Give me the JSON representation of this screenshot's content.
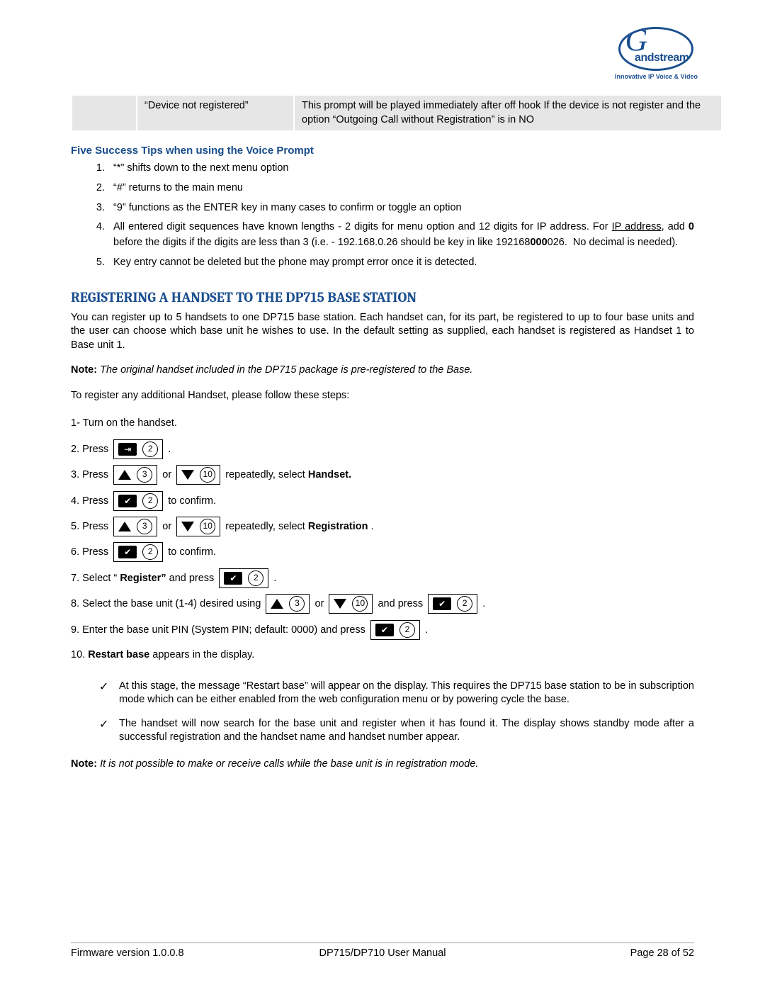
{
  "logo": {
    "brand": "Grandstream",
    "tagline": "Innovative IP Voice & Video"
  },
  "prompt_table": {
    "col1": "“Device not registered”",
    "col2": "This prompt will be played immediately after off hook If the device is not register and the option “Outgoing Call without Registration” is in NO"
  },
  "tips": {
    "heading": "Five Success Tips when using the Voice Prompt",
    "items": [
      "“*” shifts down to the next menu option",
      "“#” returns to the main menu",
      "“9” functions as the ENTER key in many cases to confirm or toggle an option",
      "All entered digit sequences have known lengths - 2 digits for menu option and 12 digits for IP address. For IP address, add 0 before the digits if the digits are less than 3 (i.e. - 192.168.0.26 should be key in like 192168000026.  No decimal is needed).",
      "Key entry cannot be deleted but the phone may prompt error once it is detected."
    ]
  },
  "section": {
    "heading": "REGISTERING A HANDSET TO THE DP715 BASE STATION",
    "p1": "You can register up to 5 handsets to one DP715 base station. Each handset can, for its part, be registered to up to four base units and the user can choose which base unit he wishes to use. In the default setting as supplied, each handset is registered as Handset 1 to Base unit 1.",
    "note1_label": "Note:",
    "note1_body": " The original handset included in the DP715 package is pre-registered to the Base.",
    "p2": "To register any additional Handset, please follow these steps:",
    "steps": {
      "s1": "1- Turn on the handset.",
      "s2_a": "2.  Press ",
      "s2_b": " .",
      "s3_a": "3.  Press ",
      "s3_or": "  or  ",
      "s3_b": " repeatedly, select ",
      "s3_bold": "Handset.",
      "s4_a": "4.  Press ",
      "s4_b": " to confirm.",
      "s5_a": "5.  Press ",
      "s5_or": "  or  ",
      "s5_b": " repeatedly, select ",
      "s5_bold": "Registration",
      "s5_c": ".",
      "s6_a": "6.  Press",
      "s6_b": " to confirm.",
      "s7_a": "7.  Select “",
      "s7_bold": "Register”",
      "s7_b": " and press  ",
      "s7_c": " .",
      "s8_a": "8.  Select the base unit (1-4) desired using  ",
      "s8_or": " or  ",
      "s8_b": "  and press  ",
      "s8_c": " .",
      "s9_a": "9.  Enter the base unit PIN (System PIN; default: 0000) and press  ",
      "s9_b": " .",
      "s10_a": "10. ",
      "s10_bold": "Restart base",
      "s10_b": " appears in the display."
    },
    "checks": [
      "At this stage, the message “Restart base” will appear on the display. This requires the DP715 base station to be in subscription mode which can be either enabled from the web configuration menu or by powering cycle the base.",
      "The handset will now search for the base unit and register when it has found it. The display shows standby mode after a successful registration and the handset name and handset number appear."
    ],
    "note2_label": "Note:",
    "note2_body": " It is not possible to make or receive calls while the base unit is in registration mode."
  },
  "icons": {
    "menu": "⇥",
    "check": "✔",
    "two": "2",
    "three": "3",
    "ten": "10"
  },
  "footer": {
    "left": "Firmware version 1.0.0.8",
    "mid": "DP715/DP710 User Manual",
    "right": "Page 28 of 52"
  }
}
